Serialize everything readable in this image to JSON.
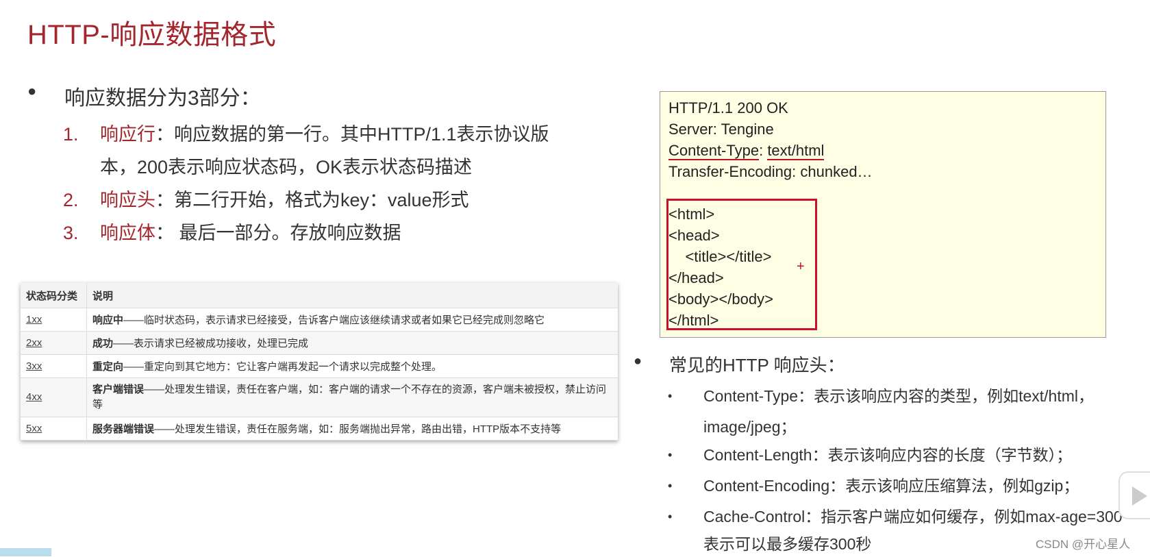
{
  "title": "HTTP-响应数据格式",
  "main_bullet": "响应数据分为3部分：",
  "parts": [
    {
      "num": "1.",
      "name": "响应行",
      "desc_line1": "：响应数据的第一行。其中HTTP/1.1表示协议版",
      "desc_line2": "本，200表示响应状态码，OK表示状态码描述"
    },
    {
      "num": "2.",
      "name": "响应头",
      "desc_line1": "：第二行开始，格式为key：value形式"
    },
    {
      "num": "3.",
      "name": "响应体",
      "desc_line1": "： 最后一部分。存放响应数据"
    }
  ],
  "status_table": {
    "headers": [
      "状态码分类",
      "说明"
    ],
    "rows": [
      {
        "code": "1xx",
        "bold": "响应中",
        "text": "——临时状态码，表示请求已经接受，告诉客户端应该继续请求或者如果它已经完成则忽略它"
      },
      {
        "code": "2xx",
        "bold": "成功",
        "text": "——表示请求已经被成功接收，处理已完成"
      },
      {
        "code": "3xx",
        "bold": "重定向",
        "text": "——重定向到其它地方：它让客户端再发起一个请求以完成整个处理。"
      },
      {
        "code": "4xx",
        "bold": "客户端错误",
        "text": "——处理发生错误，责任在客户端，如：客户端的请求一个不存在的资源，客户端未被授权，禁止访问等"
      },
      {
        "code": "5xx",
        "bold": "服务器端错误",
        "text": "——处理发生错误，责任在服务端，如：服务端抛出异常，路由出错，HTTP版本不支持等"
      }
    ]
  },
  "code_sample": {
    "status_line": "HTTP/1.1 200 OK",
    "server": "Server: Tengine",
    "ct_key": "Content-Type",
    "ct_sep": ": ",
    "ct_val": "text/html",
    "transfer": "Transfer-Encoding: chunked…",
    "body_lines": [
      "<html>",
      "<head>",
      "    <title></title>",
      "</head>",
      "<body></body>",
      "</html>"
    ],
    "plus": "+"
  },
  "common_headers_title": "常见的HTTP 响应头：",
  "common_headers": [
    {
      "line1": "Content-Type：表示该响应内容的类型，例如text/html，",
      "line2": "image/jpeg；"
    },
    {
      "line1": "Content-Length：表示该响应内容的长度（字节数）；"
    },
    {
      "line1": "Content-Encoding：表示该响应压缩算法，例如gzip；"
    },
    {
      "line1": "Cache-Control：指示客户端应如何缓存，例如max-age=300",
      "line2": "表示可以最多缓存300秒"
    }
  ],
  "watermark": "CSDN @开心星人"
}
